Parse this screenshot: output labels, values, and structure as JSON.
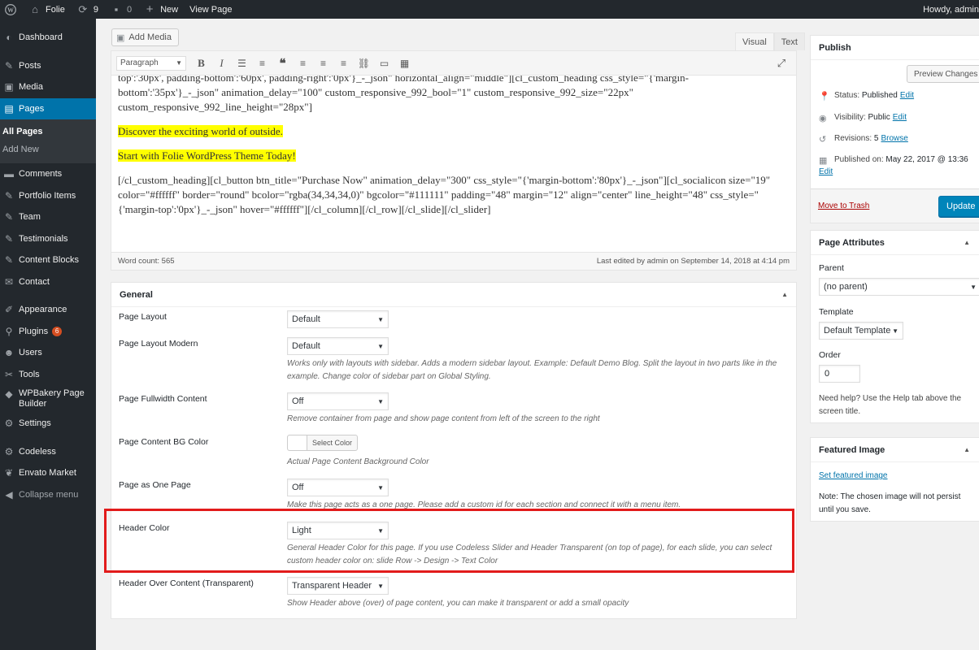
{
  "admin_bar": {
    "site_name": "Folie",
    "updates_count": "9",
    "comments_count": "0",
    "new_label": "New",
    "view_page_label": "View Page",
    "greeting": "Howdy, admin"
  },
  "sidebar": {
    "items": [
      {
        "label": "Dashboard",
        "icon": "dashboard-icon"
      },
      {
        "label": "Posts",
        "icon": "pin-icon"
      },
      {
        "label": "Media",
        "icon": "media-icon"
      },
      {
        "label": "Pages",
        "icon": "pages-icon"
      },
      {
        "label": "Comments",
        "icon": "comment-icon"
      },
      {
        "label": "Portfolio Items",
        "icon": "pin-icon"
      },
      {
        "label": "Team",
        "icon": "pin-icon"
      },
      {
        "label": "Testimonials",
        "icon": "pin-icon"
      },
      {
        "label": "Content Blocks",
        "icon": "pin-icon"
      },
      {
        "label": "Contact",
        "icon": "mail-icon"
      },
      {
        "label": "Appearance",
        "icon": "brush-icon"
      },
      {
        "label": "Plugins",
        "icon": "plugin-icon",
        "badge": "6"
      },
      {
        "label": "Users",
        "icon": "user-icon"
      },
      {
        "label": "Tools",
        "icon": "wrench-icon"
      },
      {
        "label": "WPBakery Page Builder",
        "icon": "wpbakery-icon"
      },
      {
        "label": "Settings",
        "icon": "settings-icon"
      },
      {
        "label": "Codeless",
        "icon": "gear-icon"
      },
      {
        "label": "Envato Market",
        "icon": "leaf-icon"
      },
      {
        "label": "Collapse menu",
        "icon": "collapse-icon"
      }
    ],
    "pages_submenu": [
      "All Pages",
      "Add New"
    ]
  },
  "editor": {
    "add_media_label": "Add Media",
    "tabs": [
      "Visual",
      "Text"
    ],
    "format_select": "Paragraph",
    "content": {
      "clipped_line": "top':'30px', padding-bottom':'60px', padding-right':'0px'}_-_json\" horizontal_align=\"middle\"][cl_custom_heading css_style=\"{'margin-",
      "line2": "bottom':'35px'}_-_json\" animation_delay=\"100\" custom_responsive_992_bool=\"1\" custom_responsive_992_size=\"22px\"",
      "line3": "custom_responsive_992_line_height=\"28px\"]",
      "highlight1": "Discover the exciting world of outside.",
      "highlight2": "Start with Folie WordPress Theme Today!",
      "shortcode_para": "[/cl_custom_heading][cl_button btn_title=\"Purchase Now\" animation_delay=\"300\" css_style=\"{'margin-bottom':'80px'}_-_json\"][cl_socialicon size=\"19\" color=\"#ffffff\" border=\"round\" bcolor=\"rgba(34,34,34,0)\" bgcolor=\"#111111\" padding=\"48\" margin=\"12\" align=\"center\" line_height=\"48\" css_style=\"{'margin-top':'0px'}_-_json\" hover=\"#ffffff\"][/cl_column][/cl_row][/cl_slide][/cl_slider]"
    },
    "word_count": "Word count: 565",
    "last_edited": "Last edited by admin on September 14, 2018 at 4:14 pm"
  },
  "general_box": {
    "title": "General",
    "options": {
      "page_layout": {
        "label": "Page Layout",
        "value": "Default"
      },
      "page_layout_modern": {
        "label": "Page Layout Modern",
        "value": "Default",
        "desc": "Works only with layouts with sidebar. Adds a modern sidebar layout. Example: Default Demo Blog. Split the layout in two parts like in the example. Change color of sidebar part on Global Styling."
      },
      "fullwidth": {
        "label": "Page Fullwidth Content",
        "value": "Off",
        "desc": "Remove container from page and show page content from left of the screen to the right"
      },
      "bg_color": {
        "label": "Page Content BG Color",
        "button": "Select Color",
        "desc": "Actual Page Content Background Color"
      },
      "one_page": {
        "label": "Page as One Page",
        "value": "Off",
        "desc": "Make this page acts as a one page. Please add a custom id for each section and connect it with a menu item."
      },
      "header_color": {
        "label": "Header Color",
        "value": "Light",
        "desc": "General Header Color for this page. If you use Codeless Slider and Header Transparent (on top of page), for each slide, you can select custom header color on: slide Row -> Design -> Text Color"
      },
      "header_over": {
        "label": "Header Over Content (Transparent)",
        "value": "Transparent Header",
        "desc": "Show Header above (over) of page content, you can make it transparent or add a small opacity"
      }
    }
  },
  "publish_box": {
    "title": "Publish",
    "preview_label": "Preview Changes",
    "status_label": "Status:",
    "status_value": "Published",
    "visibility_label": "Visibility:",
    "visibility_value": "Public",
    "revisions_label": "Revisions:",
    "revisions_value": "5",
    "browse_label": "Browse",
    "published_on_label": "Published on:",
    "published_on_value": "May 22, 2017 @ 13:36",
    "edit_label": "Edit",
    "trash_label": "Move to Trash",
    "update_label": "Update"
  },
  "attributes_box": {
    "title": "Page Attributes",
    "parent_label": "Parent",
    "parent_value": "(no parent)",
    "template_label": "Template",
    "template_value": "Default Template",
    "order_label": "Order",
    "order_value": "0",
    "help_text": "Need help? Use the Help tab above the screen title."
  },
  "featured_box": {
    "title": "Featured Image",
    "set_link": "Set featured image",
    "note": "Note: The chosen image will not persist until you save."
  },
  "colors": {
    "admin_dark": "#23282d",
    "accent": "#0073aa",
    "highlight_outline": "#e21b1b",
    "text_highlight": "#ffff00",
    "badge": "#d54e21"
  }
}
